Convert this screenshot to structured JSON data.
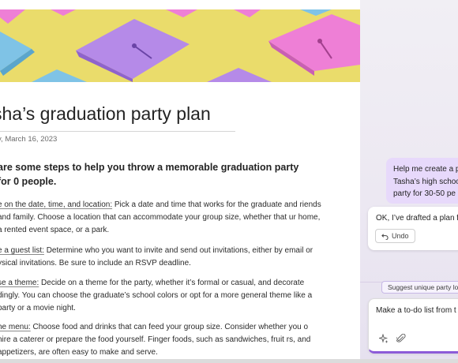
{
  "document": {
    "title": "sha’s graduation party plan",
    "date": "y, March 16, 2023",
    "intro": "are some steps to help you throw a memorable graduation party for 0 people.",
    "steps": [
      {
        "lead": "e on the date, time, and location:",
        "body": " Pick a date and time that works for the graduate and riends and family. Choose a location that can accommodate your group size, whether that ur home, a rented event space, or a park."
      },
      {
        "lead": "e a guest list:",
        "body": " Determine who you want to invite and send out invitations, either by email or ysical invitations. Be sure to include an RSVP deadline."
      },
      {
        "lead": "se a theme:",
        "body": " Decide on a theme for the party, whether it’s formal or casual, and decorate dingly. You can choose the graduate’s school colors or opt for a more general theme like a party or a movie night."
      },
      {
        "lead": "he menu:",
        "body": " Choose food and drinks that can feed your group size. Consider whether you o hire a caterer or prepare the food yourself. Finger foods, such as sandwiches, fruit rs, and appetizers, are often easy to make and serve."
      }
    ]
  },
  "copilot": {
    "user_message": "Help me create a p Tasha’s high schoo party for 30-50 pe",
    "ai_message": "OK, I’ve drafted a plan fr",
    "undo_label": "Undo",
    "suggestion": "Suggest unique party loc",
    "compose_text": "Make a to-do list from t",
    "icons": [
      "sparkle-icon",
      "paperclip-icon",
      "undo-icon"
    ]
  },
  "colors": {
    "banner_yellow": "#eadc6b",
    "cap_purple": "#b58ae8",
    "cap_blue": "#7fc3e6",
    "cap_pink": "#ee7fd6",
    "user_bubble": "#e7d9fb",
    "accent": "#8d5bd8"
  }
}
